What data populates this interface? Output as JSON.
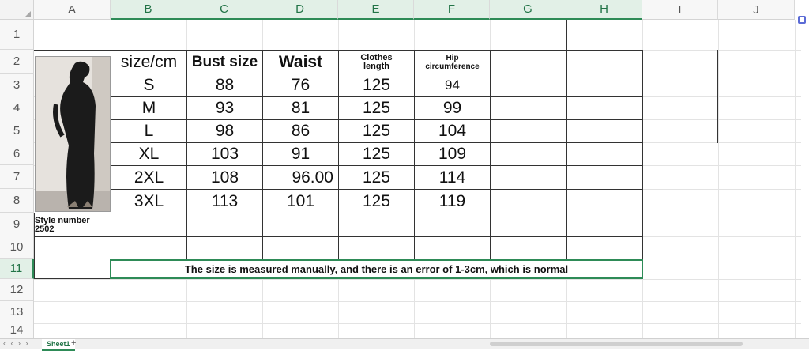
{
  "columns": [
    "A",
    "B",
    "C",
    "D",
    "E",
    "F",
    "G",
    "H",
    "I",
    "J"
  ],
  "rows": [
    "1",
    "2",
    "3",
    "4",
    "5",
    "6",
    "7",
    "8",
    "9",
    "10",
    "11",
    "12",
    "13",
    "14"
  ],
  "table": {
    "header": {
      "size_cm": "size/cm",
      "bust": "Bust size",
      "waist": "Waist",
      "clothes_length_1": "Clothes",
      "clothes_length_2": "length",
      "hip_1": "Hip",
      "hip_2": "circumference"
    },
    "rows": [
      {
        "size": "S",
        "bust": "88",
        "waist": "76",
        "length": "125",
        "hip": "94"
      },
      {
        "size": "M",
        "bust": "93",
        "waist": "81",
        "length": "125",
        "hip": "99"
      },
      {
        "size": "L",
        "bust": "98",
        "waist": "86",
        "length": "125",
        "hip": "104"
      },
      {
        "size": "XL",
        "bust": "103",
        "waist": "91",
        "length": "125",
        "hip": "109"
      },
      {
        "size": "2XL",
        "bust": "108",
        "waist": "96.00",
        "length": "125",
        "hip": "114"
      },
      {
        "size": "3XL",
        "bust": "113",
        "waist": "101",
        "length": "125",
        "hip": "119"
      }
    ]
  },
  "style_number": {
    "label": "Style number",
    "value": "2502"
  },
  "note": "The size is measured manually, and there is an error of 1-3cm, which is normal",
  "sheet_tab": "Sheet1",
  "add_tab": "+",
  "nav_arrows": "‹ ‹ › ›",
  "colors": {
    "accent": "#2e8b57",
    "dress": "#1b1b1b"
  }
}
